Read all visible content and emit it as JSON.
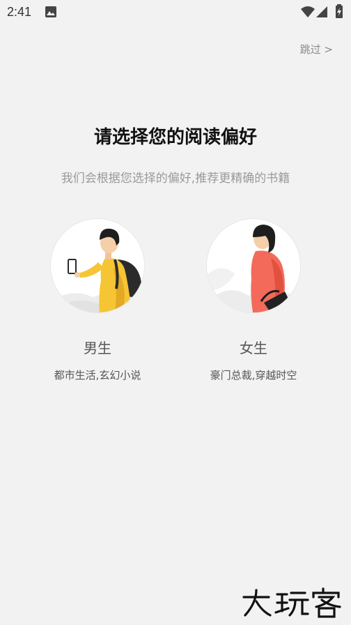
{
  "status_bar": {
    "time": "2:41",
    "icons": [
      "image-icon",
      "wifi-icon",
      "signal-icon",
      "battery-icon"
    ]
  },
  "header": {
    "skip_label": "跳过 >"
  },
  "main": {
    "title": "请选择您的阅读偏好",
    "subtitle": "我们会根据您选择的偏好,推荐更精确的书籍",
    "options": [
      {
        "label": "男生",
        "desc": "都市生活,玄幻小说"
      },
      {
        "label": "女生",
        "desc": "豪门总裁,穿越时空"
      }
    ]
  },
  "watermark": {
    "text": "大玩客"
  },
  "colors": {
    "background": "#f2f2f2",
    "title": "#111111",
    "subtitle": "#9a9a9a",
    "male_accent": "#f6c533",
    "female_accent": "#f36a5b"
  }
}
